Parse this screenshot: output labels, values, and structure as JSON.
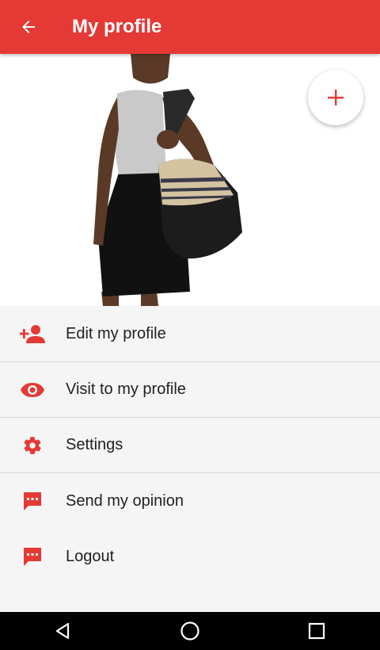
{
  "app_bar": {
    "title": "My profile",
    "background": "#e53935",
    "back_icon": "arrow-back-icon"
  },
  "profile_photo": {
    "description_icon": "profile-photo",
    "add_button_icon": "plus-icon"
  },
  "menu": {
    "accent_color": "#e53935",
    "items": [
      {
        "label": "Edit my profile",
        "icon": "person-add-icon"
      },
      {
        "label": "Visit to my profile",
        "icon": "eye-icon"
      },
      {
        "label": "Settings",
        "icon": "gear-icon"
      },
      {
        "label": "Send my opinion",
        "icon": "chat-bubble-icon"
      },
      {
        "label": "Logout",
        "icon": "chat-bubble-icon"
      }
    ]
  },
  "nav_bar": {
    "buttons": [
      "back-triangle-icon",
      "home-circle-icon",
      "recents-square-icon"
    ]
  }
}
